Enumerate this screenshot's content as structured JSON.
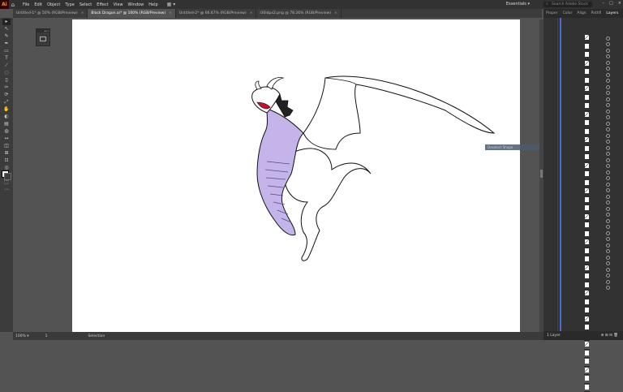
{
  "app": {
    "logo": "Ai",
    "home_icon": "home-icon"
  },
  "menu": [
    "File",
    "Edit",
    "Object",
    "Type",
    "Select",
    "Effect",
    "View",
    "Window",
    "Help"
  ],
  "layout_icon": "▦ ▾",
  "workspace": "Essentials ▾",
  "search": {
    "placeholder": "Search Adobe Stock"
  },
  "window_controls": [
    "–",
    "□",
    "×"
  ],
  "tabs": [
    {
      "label": "Untitled-1* @ 50% (RGB/Preview)",
      "close": "×"
    },
    {
      "label": "Black Dragon.ai* @ 100% (RGB/Preview)",
      "close": "×"
    },
    {
      "label": "Untitled-2* @ 66.67% (RGB/Preview)",
      "close": "×"
    },
    {
      "label": "l30ldpx2.png @ 78.26% (RGB/Preview)",
      "close": "×"
    }
  ],
  "float_panel": {
    "header": "◂◂ ×"
  },
  "tools": [
    "▸",
    "↖",
    "✎",
    "✒",
    "▭",
    "T",
    "⟋",
    "◌",
    "▯",
    "✂",
    "⟳",
    "⤢",
    "✋",
    "◐",
    "▤",
    "◍",
    "↔",
    "◫",
    "⊞",
    "⊡",
    "◎",
    "▣",
    "⬚",
    "⋯"
  ],
  "panel_tabs": [
    {
      "label": "Proper"
    },
    {
      "label": "Color"
    },
    {
      "label": "Align"
    },
    {
      "label": "Pathfi"
    },
    {
      "label": "Layers",
      "active": true
    }
  ],
  "hint": "Deselect Shape",
  "status": {
    "zoom": "100% ▾",
    "page": "1",
    "mode": "Selection"
  },
  "layers_footer": {
    "count": "1 Layer",
    "icons": "⊕ ⊞ ⊟ 🗑"
  },
  "colors": {
    "fill": "#ffffff",
    "stroke": "#e33333",
    "dragon_fill": "#c4b4ea",
    "accent": "#4a6ecf"
  }
}
